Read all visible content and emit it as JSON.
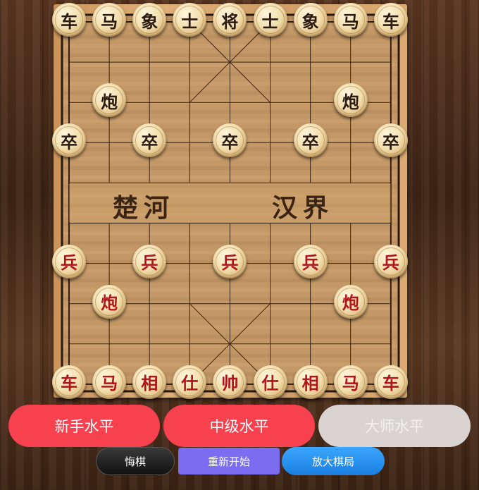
{
  "board": {
    "river_left": "楚河",
    "river_right": "汉界",
    "pieces": [
      {
        "text": "车",
        "side": "black",
        "col": 0,
        "row": 0
      },
      {
        "text": "马",
        "side": "black",
        "col": 1,
        "row": 0
      },
      {
        "text": "象",
        "side": "black",
        "col": 2,
        "row": 0
      },
      {
        "text": "士",
        "side": "black",
        "col": 3,
        "row": 0
      },
      {
        "text": "将",
        "side": "black",
        "col": 4,
        "row": 0
      },
      {
        "text": "士",
        "side": "black",
        "col": 5,
        "row": 0
      },
      {
        "text": "象",
        "side": "black",
        "col": 6,
        "row": 0
      },
      {
        "text": "马",
        "side": "black",
        "col": 7,
        "row": 0
      },
      {
        "text": "车",
        "side": "black",
        "col": 8,
        "row": 0
      },
      {
        "text": "炮",
        "side": "black",
        "col": 1,
        "row": 2
      },
      {
        "text": "炮",
        "side": "black",
        "col": 7,
        "row": 2
      },
      {
        "text": "卒",
        "side": "black",
        "col": 0,
        "row": 3
      },
      {
        "text": "卒",
        "side": "black",
        "col": 2,
        "row": 3
      },
      {
        "text": "卒",
        "side": "black",
        "col": 4,
        "row": 3
      },
      {
        "text": "卒",
        "side": "black",
        "col": 6,
        "row": 3
      },
      {
        "text": "卒",
        "side": "black",
        "col": 8,
        "row": 3
      },
      {
        "text": "兵",
        "side": "red",
        "col": 0,
        "row": 6
      },
      {
        "text": "兵",
        "side": "red",
        "col": 2,
        "row": 6
      },
      {
        "text": "兵",
        "side": "red",
        "col": 4,
        "row": 6
      },
      {
        "text": "兵",
        "side": "red",
        "col": 6,
        "row": 6
      },
      {
        "text": "兵",
        "side": "red",
        "col": 8,
        "row": 6
      },
      {
        "text": "炮",
        "side": "red",
        "col": 1,
        "row": 7
      },
      {
        "text": "炮",
        "side": "red",
        "col": 7,
        "row": 7
      },
      {
        "text": "车",
        "side": "red",
        "col": 0,
        "row": 9
      },
      {
        "text": "马",
        "side": "red",
        "col": 1,
        "row": 9
      },
      {
        "text": "相",
        "side": "red",
        "col": 2,
        "row": 9
      },
      {
        "text": "仕",
        "side": "red",
        "col": 3,
        "row": 9
      },
      {
        "text": "帅",
        "side": "red",
        "col": 4,
        "row": 9
      },
      {
        "text": "仕",
        "side": "red",
        "col": 5,
        "row": 9
      },
      {
        "text": "相",
        "side": "red",
        "col": 6,
        "row": 9
      },
      {
        "text": "马",
        "side": "red",
        "col": 7,
        "row": 9
      },
      {
        "text": "车",
        "side": "red",
        "col": 8,
        "row": 9
      }
    ]
  },
  "levels": {
    "beginner": "新手水平",
    "intermediate": "中级水平",
    "master": "大师水平"
  },
  "actions": {
    "undo": "悔棋",
    "restart": "重新开始",
    "enlarge": "放大棋局"
  },
  "colors": {
    "level_active": "#f8414f",
    "level_disabled": "#d9d4d2",
    "undo": "#222222",
    "restart": "#7b6cf0",
    "enlarge": "#2a93ef"
  }
}
